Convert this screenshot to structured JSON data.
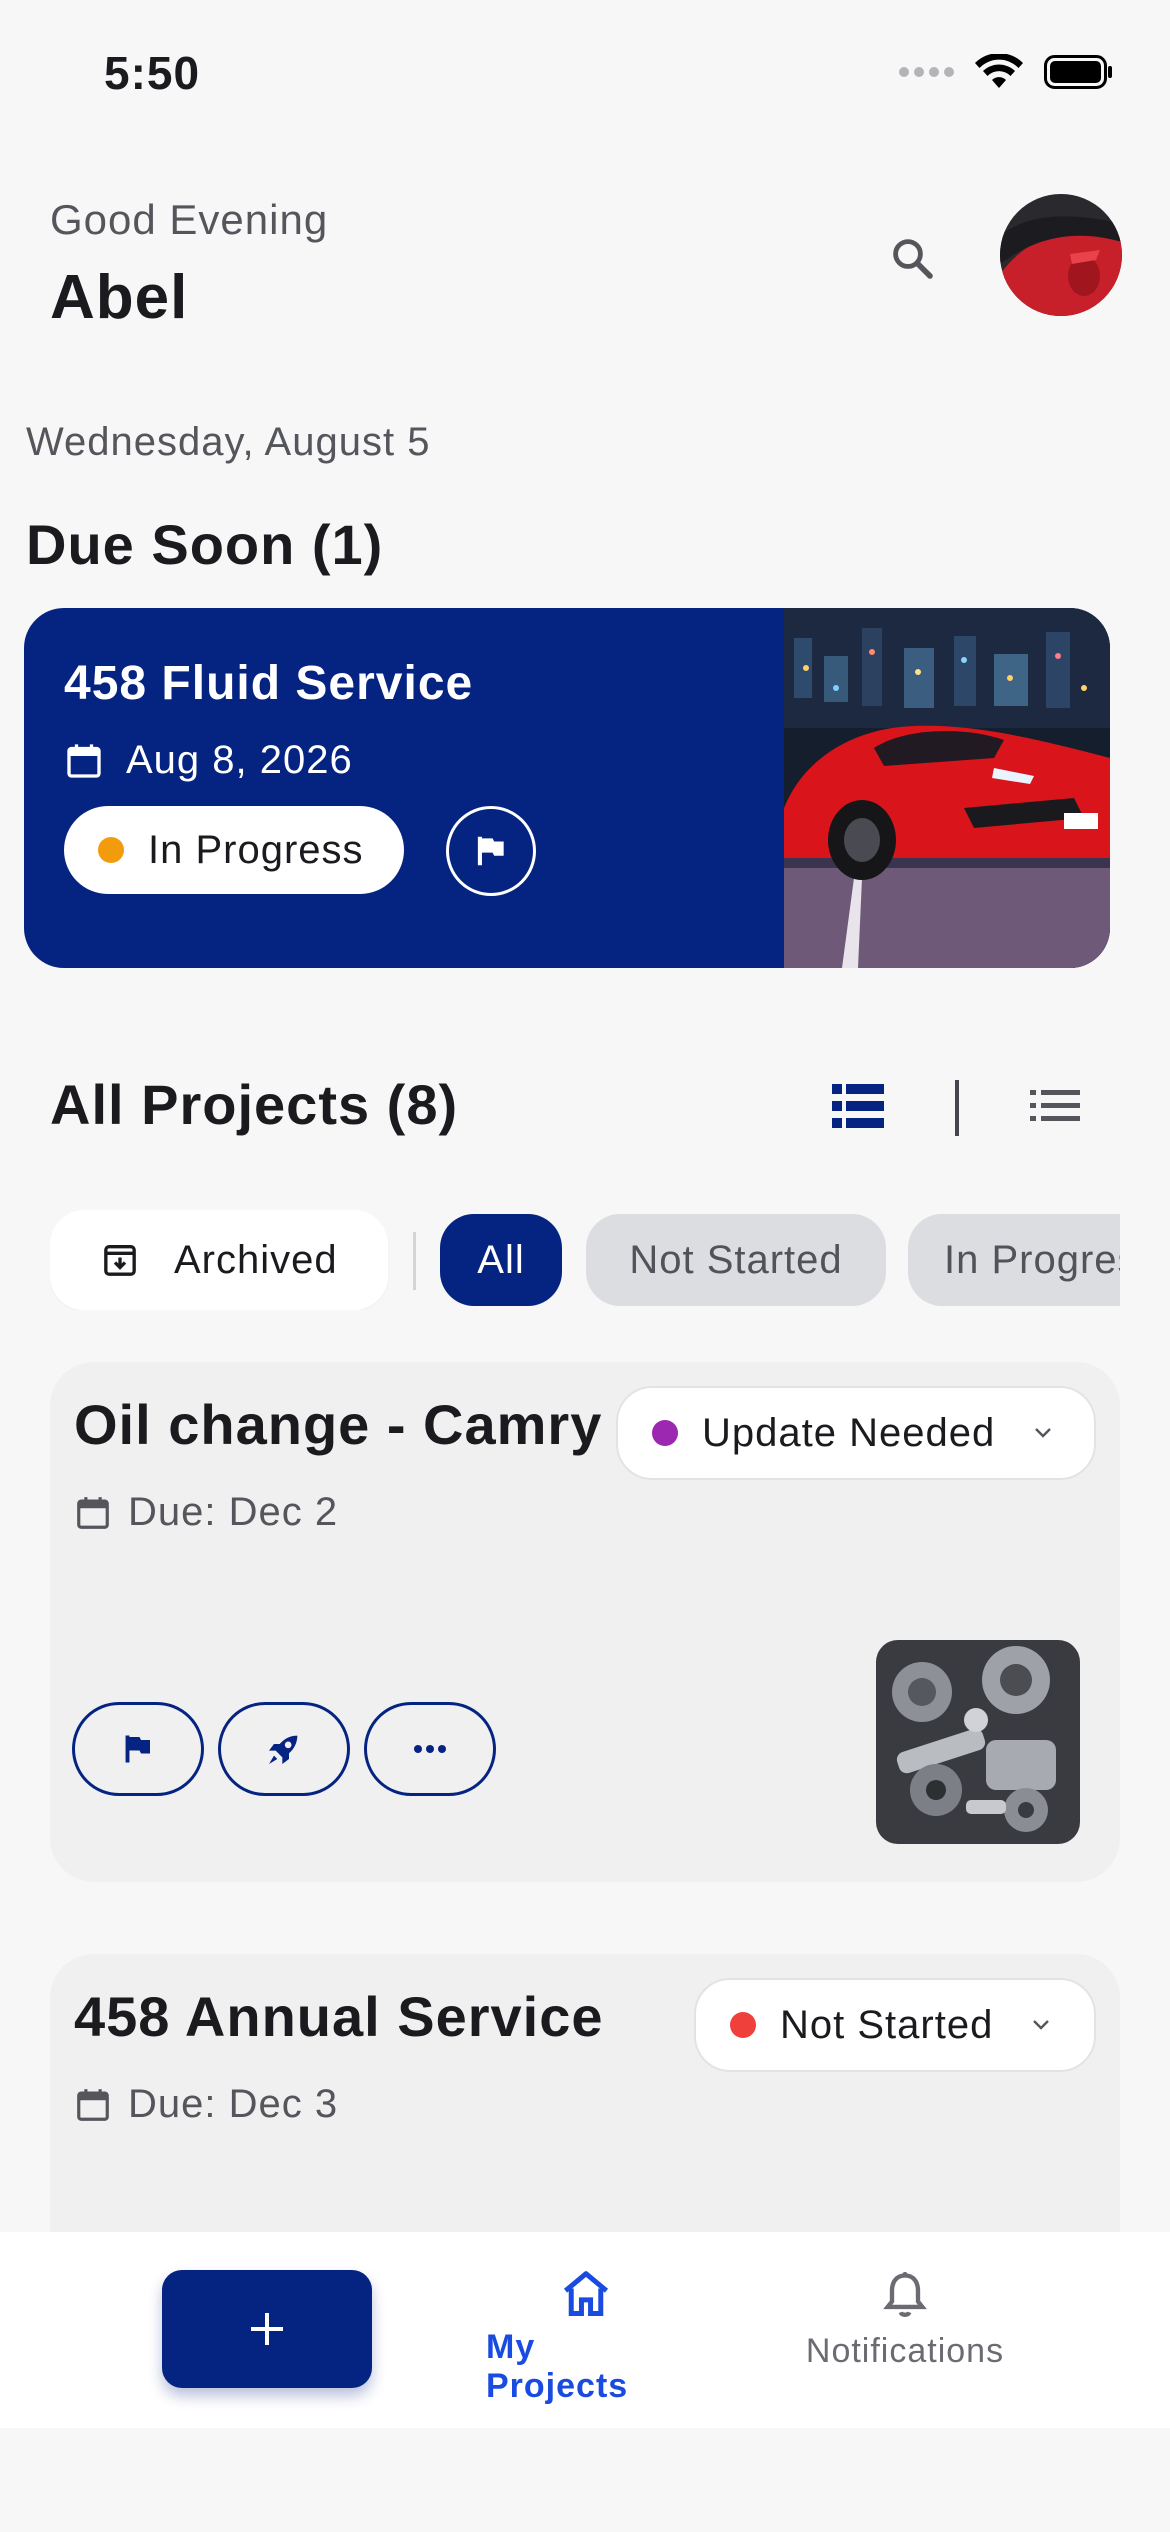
{
  "status_bar": {
    "time": "5:50"
  },
  "header": {
    "greeting": "Good Evening",
    "name": "Abel"
  },
  "date": "Wednesday, August 5",
  "due_soon": {
    "title": "Due Soon (1)",
    "card": {
      "title": "458 Fluid Service",
      "date": "Aug 8, 2026",
      "status": "In Progress",
      "status_color": "#f29b0c"
    }
  },
  "all_projects": {
    "title": "All Projects (8)",
    "filters": {
      "archived": "Archived",
      "chips": [
        "All",
        "Not Started",
        "In Progress"
      ]
    },
    "items": [
      {
        "title": "Oil change - Camry",
        "due": "Due: Dec 2",
        "status": "Update Needed",
        "status_color": "#9c27b0"
      },
      {
        "title": "458 Annual Service",
        "due": "Due: Dec 3",
        "status": "Not Started",
        "status_color": "#f0403b"
      }
    ]
  },
  "bottom_nav": {
    "home_label": "My Projects",
    "notifications_label": "Notifications"
  },
  "colors": {
    "brand": "#052381",
    "active_nav": "#1a4be0",
    "background": "#f7f7f8",
    "card_bg": "#f1f0f0"
  }
}
